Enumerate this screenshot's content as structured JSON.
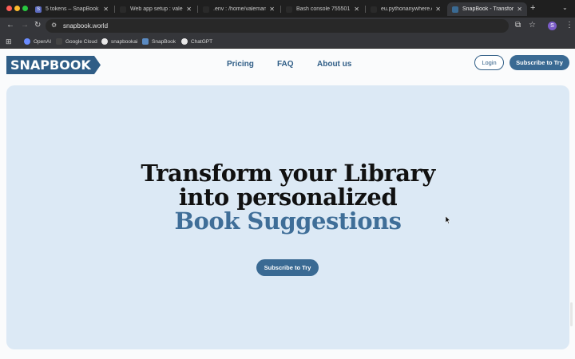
{
  "browser": {
    "tabs": [
      {
        "title": "5 tokens – SnapBook -",
        "favicon_color": "#5c6bc0"
      },
      {
        "title": "Web app setup : valeri",
        "favicon_color": "#1f1f1f"
      },
      {
        "title": ".env : /home/valeman10",
        "favicon_color": "#1f1f1f"
      },
      {
        "title": "Bash console 755501 :",
        "favicon_color": "#1f1f1f"
      },
      {
        "title": "eu.pythonanywhere.com",
        "favicon_color": "#1f1f1f"
      },
      {
        "title": "SnapBook - Transform",
        "favicon_color": "#3a6a93",
        "active": true
      }
    ],
    "url": "snapbook.world",
    "profile_initial": "S",
    "bookmarks": [
      {
        "label": "OpenAI",
        "icon": "openai-icon"
      },
      {
        "label": "Google Cloud",
        "icon": "google-cloud-icon"
      },
      {
        "label": "snapbookai",
        "icon": "github-icon"
      },
      {
        "label": "SnapBook",
        "icon": "snapbook-icon"
      },
      {
        "label": "ChatGPT",
        "icon": "chatgpt-icon"
      }
    ]
  },
  "site": {
    "logo_text": "SNAPBOOK",
    "nav": [
      "Pricing",
      "FAQ",
      "About us"
    ],
    "login_label": "Login",
    "subscribe_label": "Subscribe to Try",
    "hero": {
      "line1": "Transform your Library",
      "line2": "into personalized",
      "line3": "Book Suggestions",
      "cta": "Subscribe to Try"
    }
  },
  "colors": {
    "brand": "#2f5d86",
    "button": "#3a6a93",
    "hero_bg": "#dce9f5"
  }
}
